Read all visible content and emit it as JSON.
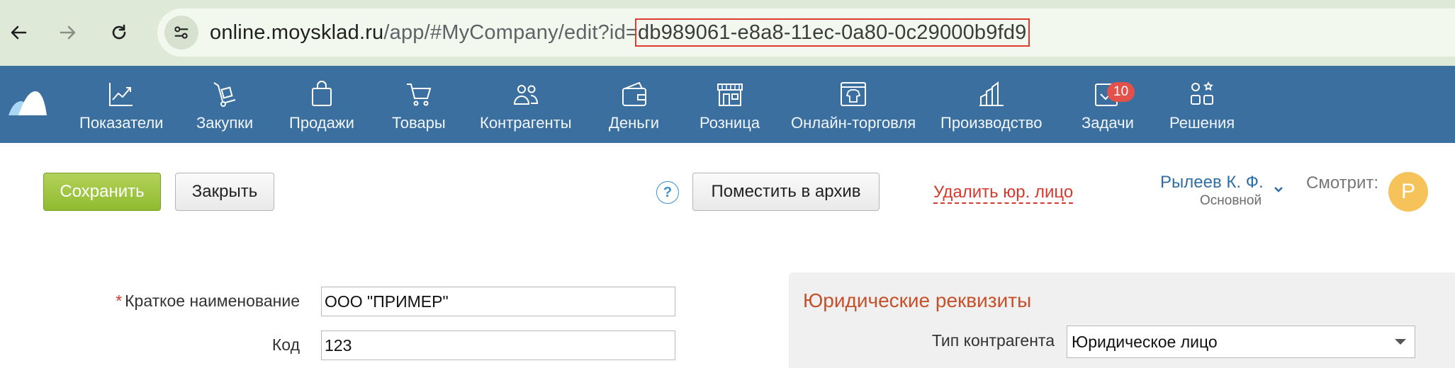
{
  "browser": {
    "url_host": "online.moysklad.ru",
    "url_path": "/app/#MyCompany/edit?id=",
    "url_id": "db989061-e8a8-11ec-0a80-0c29000b9fd9"
  },
  "nav": {
    "items": [
      {
        "label": "Показатели",
        "icon": "chart-icon"
      },
      {
        "label": "Закупки",
        "icon": "dolly-icon"
      },
      {
        "label": "Продажи",
        "icon": "shopping-bag-icon"
      },
      {
        "label": "Товары",
        "icon": "cart-icon"
      },
      {
        "label": "Контрагенты",
        "icon": "people-icon"
      },
      {
        "label": "Деньги",
        "icon": "wallet-icon"
      },
      {
        "label": "Розница",
        "icon": "store-icon"
      },
      {
        "label": "Онлайн-торговля",
        "icon": "online-store-icon"
      },
      {
        "label": "Производство",
        "icon": "factory-icon"
      },
      {
        "label": "Задачи",
        "icon": "tasks-icon",
        "badge": "10"
      },
      {
        "label": "Решения",
        "icon": "apps-icon"
      }
    ]
  },
  "toolbar": {
    "save_label": "Сохранить",
    "close_label": "Закрыть",
    "help_label": "?",
    "archive_label": "Поместить в архив",
    "delete_label": "Удалить юр. лицо",
    "user_name": "Рылеев К. Ф.",
    "user_role": "Основной",
    "watching_label": "Смотрит:",
    "avatar_letter": "Р"
  },
  "form": {
    "required_mark": "*",
    "short_name_label": "Краткое наименование",
    "short_name_value": "ООО \"ПРИМЕР\"",
    "code_label": "Код",
    "code_value": "123"
  },
  "legal": {
    "title": "Юридические реквизиты",
    "type_label": "Тип контрагента",
    "type_value": "Юридическое лицо"
  },
  "colors": {
    "nav_bg": "#3a6f9f",
    "save_button": "#9bc43a",
    "delete_link": "#d23b2e",
    "panel_title": "#c6502a",
    "badge": "#e3524a",
    "avatar": "#f6c35b"
  }
}
